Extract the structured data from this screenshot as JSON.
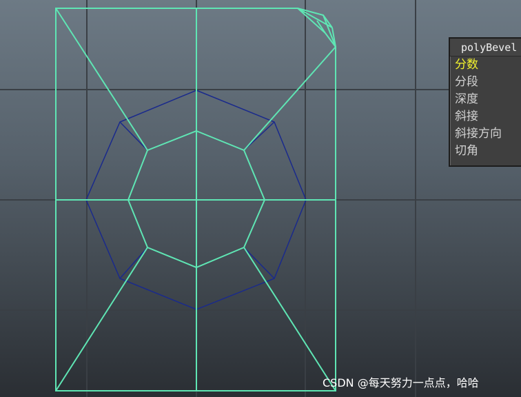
{
  "viewport": {
    "grid_color": "#3a3f45",
    "cage_color": "#5fe6b4",
    "inner_ring_color": "#1a2a8c"
  },
  "channel_box": {
    "node_title": "polyBevel",
    "attributes": [
      {
        "label": "分数",
        "selected": true
      },
      {
        "label": "分段",
        "selected": false
      },
      {
        "label": "深度",
        "selected": false
      },
      {
        "label": "斜接",
        "selected": false
      },
      {
        "label": "斜接方向",
        "selected": false
      },
      {
        "label": "切角",
        "selected": false
      }
    ],
    "selected_color": "#f2f22e",
    "text_color": "#d2d2d2"
  },
  "watermark": {
    "text": "CSDN @每天努力一点点，哈哈"
  }
}
